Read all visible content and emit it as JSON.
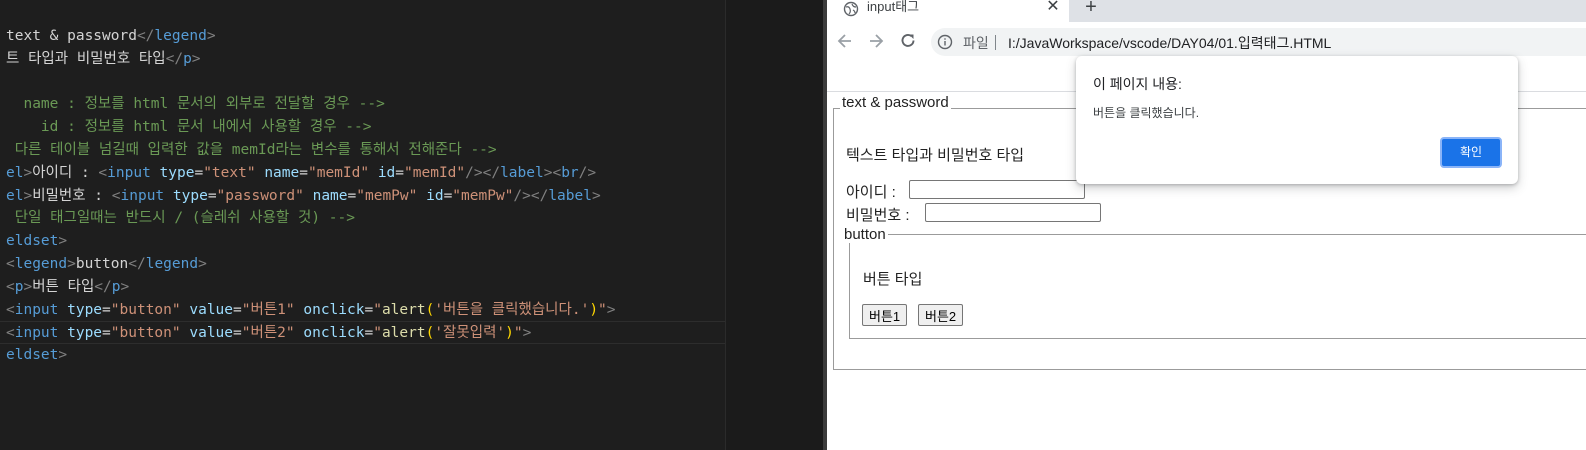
{
  "editor": {
    "lines": [
      {
        "tokens": [
          {
            "t": "text & password",
            "c": "tk-txt"
          },
          {
            "t": "</",
            "c": "tk-p"
          },
          {
            "t": "legend",
            "c": "tk-tag"
          },
          {
            "t": ">",
            "c": "tk-p"
          }
        ]
      },
      {
        "tokens": [
          {
            "t": "트 타입과 비밀번호 타입",
            "c": "tk-txt"
          },
          {
            "t": "</",
            "c": "tk-p"
          },
          {
            "t": "p",
            "c": "tk-tag"
          },
          {
            "t": ">",
            "c": "tk-p"
          }
        ]
      },
      {
        "tokens": []
      },
      {
        "tokens": [
          {
            "t": "  name : 정보를 html 문서의 외부로 전달할 경우 -->",
            "c": "tk-com"
          }
        ]
      },
      {
        "tokens": [
          {
            "t": "    id : 정보를 html 문서 내에서 사용할 경우 -->",
            "c": "tk-com"
          }
        ]
      },
      {
        "tokens": [
          {
            "t": " 다른 테이블 넘길때 입력한 값을 memId라는 변수를 통해서 전해준다 -->",
            "c": "tk-com"
          }
        ]
      },
      {
        "tokens": [
          {
            "t": "el",
            "c": "tk-tag"
          },
          {
            "t": ">",
            "c": "tk-p"
          },
          {
            "t": "아이디 : ",
            "c": "tk-txt"
          },
          {
            "t": "<",
            "c": "tk-p"
          },
          {
            "t": "input",
            "c": "tk-tag"
          },
          {
            "t": " type",
            "c": "tk-attr"
          },
          {
            "t": "=",
            "c": "tk-txt"
          },
          {
            "t": "\"text\"",
            "c": "tk-str"
          },
          {
            "t": " name",
            "c": "tk-attr"
          },
          {
            "t": "=",
            "c": "tk-txt"
          },
          {
            "t": "\"memId\"",
            "c": "tk-str"
          },
          {
            "t": " id",
            "c": "tk-attr"
          },
          {
            "t": "=",
            "c": "tk-txt"
          },
          {
            "t": "\"memId\"",
            "c": "tk-str"
          },
          {
            "t": "/></",
            "c": "tk-p"
          },
          {
            "t": "label",
            "c": "tk-tag"
          },
          {
            "t": "><",
            "c": "tk-p"
          },
          {
            "t": "br",
            "c": "tk-tag"
          },
          {
            "t": "/>",
            "c": "tk-p"
          }
        ]
      },
      {
        "tokens": [
          {
            "t": "el",
            "c": "tk-tag"
          },
          {
            "t": ">",
            "c": "tk-p"
          },
          {
            "t": "비밀번호 : ",
            "c": "tk-txt"
          },
          {
            "t": "<",
            "c": "tk-p"
          },
          {
            "t": "input",
            "c": "tk-tag"
          },
          {
            "t": " type",
            "c": "tk-attr"
          },
          {
            "t": "=",
            "c": "tk-txt"
          },
          {
            "t": "\"password\"",
            "c": "tk-str"
          },
          {
            "t": " name",
            "c": "tk-attr"
          },
          {
            "t": "=",
            "c": "tk-txt"
          },
          {
            "t": "\"memPw\"",
            "c": "tk-str"
          },
          {
            "t": " id",
            "c": "tk-attr"
          },
          {
            "t": "=",
            "c": "tk-txt"
          },
          {
            "t": "\"memPw\"",
            "c": "tk-str"
          },
          {
            "t": "/></",
            "c": "tk-p"
          },
          {
            "t": "label",
            "c": "tk-tag"
          },
          {
            "t": ">",
            "c": "tk-p"
          }
        ]
      },
      {
        "tokens": [
          {
            "t": " 단일 태그일때는 반드시 / (슬레쉬 사용할 것) -->",
            "c": "tk-com"
          }
        ]
      },
      {
        "tokens": [
          {
            "t": "eldset",
            "c": "tk-tag"
          },
          {
            "t": ">",
            "c": "tk-p"
          }
        ]
      },
      {
        "tokens": [
          {
            "t": "<",
            "c": "tk-p"
          },
          {
            "t": "legend",
            "c": "tk-tag"
          },
          {
            "t": ">",
            "c": "tk-p"
          },
          {
            "t": "button",
            "c": "tk-txt"
          },
          {
            "t": "</",
            "c": "tk-p"
          },
          {
            "t": "legend",
            "c": "tk-tag"
          },
          {
            "t": ">",
            "c": "tk-p"
          }
        ]
      },
      {
        "tokens": [
          {
            "t": "<",
            "c": "tk-p"
          },
          {
            "t": "p",
            "c": "tk-tag"
          },
          {
            "t": ">",
            "c": "tk-p"
          },
          {
            "t": "버튼 타입",
            "c": "tk-txt"
          },
          {
            "t": "</",
            "c": "tk-p"
          },
          {
            "t": "p",
            "c": "tk-tag"
          },
          {
            "t": ">",
            "c": "tk-p"
          }
        ]
      },
      {
        "tokens": [
          {
            "t": "<",
            "c": "tk-p"
          },
          {
            "t": "input",
            "c": "tk-tag"
          },
          {
            "t": " type",
            "c": "tk-attr"
          },
          {
            "t": "=",
            "c": "tk-txt"
          },
          {
            "t": "\"button\"",
            "c": "tk-str"
          },
          {
            "t": " value",
            "c": "tk-attr"
          },
          {
            "t": "=",
            "c": "tk-txt"
          },
          {
            "t": "\"버튼1\"",
            "c": "tk-str"
          },
          {
            "t": " onclick",
            "c": "tk-attr"
          },
          {
            "t": "=",
            "c": "tk-txt"
          },
          {
            "t": "\"",
            "c": "tk-str"
          },
          {
            "t": "alert",
            "c": "tk-fn"
          },
          {
            "t": "(",
            "c": "tk-br"
          },
          {
            "t": "'버튼을 클릭했습니다.'",
            "c": "tk-str"
          },
          {
            "t": ")",
            "c": "tk-br"
          },
          {
            "t": "\"",
            "c": "tk-str"
          },
          {
            "t": ">",
            "c": "tk-p"
          }
        ]
      },
      {
        "tokens": [
          {
            "t": "<",
            "c": "tk-p"
          },
          {
            "t": "input",
            "c": "tk-tag"
          },
          {
            "t": " type",
            "c": "tk-attr"
          },
          {
            "t": "=",
            "c": "tk-txt"
          },
          {
            "t": "\"button\"",
            "c": "tk-str"
          },
          {
            "t": " value",
            "c": "tk-attr"
          },
          {
            "t": "=",
            "c": "tk-txt"
          },
          {
            "t": "\"버튼2\"",
            "c": "tk-str"
          },
          {
            "t": " onclick",
            "c": "tk-attr"
          },
          {
            "t": "=",
            "c": "tk-txt"
          },
          {
            "t": "\"",
            "c": "tk-str"
          },
          {
            "t": "alert",
            "c": "tk-fn"
          },
          {
            "t": "(",
            "c": "tk-br"
          },
          {
            "t": "'잘못입력'",
            "c": "tk-str"
          },
          {
            "t": ")",
            "c": "tk-br"
          },
          {
            "t": "\"",
            "c": "tk-str"
          },
          {
            "t": ">",
            "c": "tk-p"
          }
        ]
      },
      {
        "tokens": [
          {
            "t": "eldset",
            "c": "tk-tag"
          },
          {
            "t": ">",
            "c": "tk-p"
          }
        ]
      }
    ]
  },
  "browser": {
    "tab": {
      "title": "input태그",
      "favicon": "globe-icon",
      "close_glyph": "✕"
    },
    "new_tab_glyph": "+",
    "toolbar": {
      "back_icon": "back-arrow-icon",
      "forward_icon": "forward-arrow-icon",
      "reload_icon": "reload-icon",
      "info_icon": "info-icon"
    },
    "address_bar": {
      "scheme_label": "파일",
      "url": "I:/JavaWorkspace/vscode/DAY04/01.입력태그.HTML"
    },
    "page": {
      "fieldset1": {
        "legend": "text & password",
        "paragraph": "텍스트 타입과 비밀번호 타입",
        "id_label": "아이디 :",
        "id_value": "",
        "pw_label": "비밀번호 :",
        "pw_value": ""
      },
      "fieldset2": {
        "legend": "button",
        "paragraph": "버튼 타입",
        "button1": "버튼1",
        "button2": "버튼2"
      }
    },
    "dialog": {
      "title": "이 페이지 내용:",
      "message": "버튼을 클릭했습니다.",
      "ok_label": "확인"
    }
  },
  "colors": {
    "editor_bg": "#1e1e1e",
    "accent": "#1a73e8",
    "tag": "#569cd6",
    "attr": "#9cdcfe",
    "string": "#ce9178",
    "comment": "#6a9955"
  }
}
